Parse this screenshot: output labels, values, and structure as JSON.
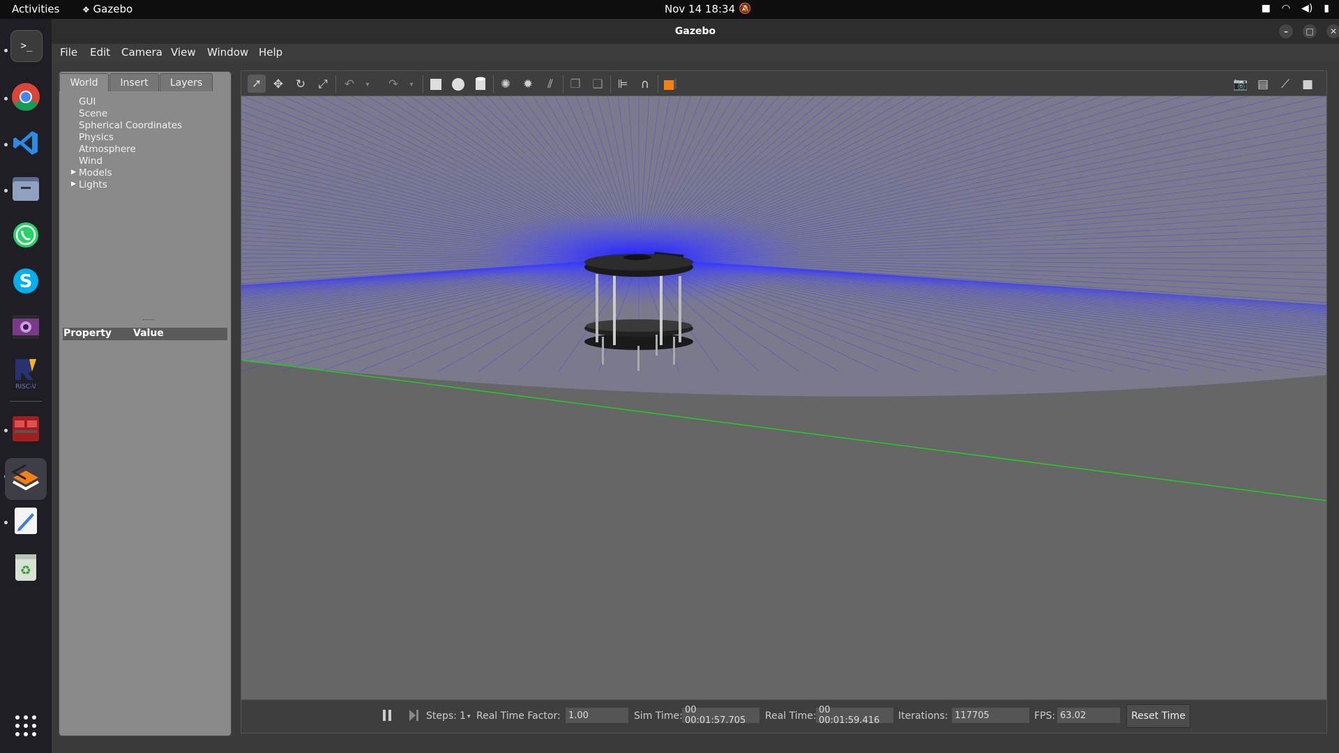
{
  "topbar": {
    "activities": "Activities",
    "app_name": "Gazebo",
    "datetime": "Nov 14  18:34"
  },
  "dock": {
    "apps": [
      "terminal-icon",
      "chrome-icon",
      "vscode-icon",
      "files-icon",
      "whatsapp-icon",
      "skype-icon",
      "video-app-icon",
      "riscv-icon",
      "red-app-icon",
      "gazebo-icon",
      "text-editor-icon",
      "trash-icon"
    ],
    "show_apps_icon": "grid-icon"
  },
  "window": {
    "title": "Gazebo",
    "menu": [
      "File",
      "Edit",
      "Camera",
      "View",
      "Window",
      "Help"
    ]
  },
  "left_panel": {
    "tabs": [
      "World",
      "Insert",
      "Layers"
    ],
    "active_tab": "World",
    "tree": [
      "GUI",
      "Scene",
      "Spherical Coordinates",
      "Physics",
      "Atmosphere",
      "Wind",
      "Models",
      "Lights"
    ],
    "expandable": [
      "Models",
      "Lights"
    ],
    "property_header": {
      "property": "Property",
      "value": "Value"
    }
  },
  "status": {
    "steps_label": "Steps:",
    "steps_value": "1",
    "rtf_label": "Real Time Factor:",
    "rtf_value": "1.00",
    "sim_time_label": "Sim Time:",
    "sim_time_value": "00 00:01:57.705",
    "real_time_label": "Real Time:",
    "real_time_value": "00 00:01:59.416",
    "iterations_label": "Iterations:",
    "iterations_value": "117705",
    "fps_label": "FPS:",
    "fps_value": "63.02",
    "reset_label": "Reset Time"
  },
  "colors": {
    "scan_rays": "#3a3aff",
    "ground": "#666666",
    "sky": "#7a7a8c",
    "x_axis": "#22cc22"
  }
}
